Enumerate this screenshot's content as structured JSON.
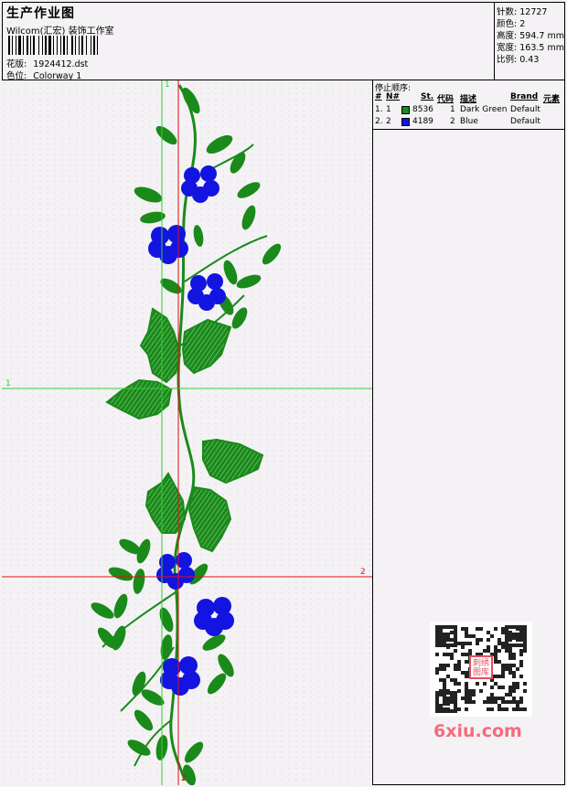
{
  "header": {
    "title": "生产作业图",
    "company": "Wilcom(汇宏) 装饰工作室",
    "file_label": "花版:",
    "file_value": "1924412.dst",
    "color_label": "色位:",
    "color_value": "Colorway 1"
  },
  "stats": [
    {
      "label": "针数:",
      "value": "12727"
    },
    {
      "label": "颜色:",
      "value": "2"
    },
    {
      "label": "高度:",
      "value": "594.7 mm"
    },
    {
      "label": "宽度:",
      "value": "163.5 mm"
    },
    {
      "label": "比例:",
      "value": "0.43"
    }
  ],
  "guides": {
    "v1": "1",
    "h1": "1",
    "h2": "2",
    "v2": "2"
  },
  "stop_sequence": {
    "caption": "停止顺序:",
    "columns": [
      "#",
      "N#",
      "St.",
      "代码",
      "描述",
      "Brand",
      "元素"
    ],
    "rows": [
      {
        "idx": "1.",
        "n": "1",
        "stitches": "8536",
        "code": "1",
        "desc": "Dark Green",
        "brand": "Default",
        "color": "#1a8a1a"
      },
      {
        "idx": "2.",
        "n": "2",
        "stitches": "4189",
        "code": "2",
        "desc": "Blue",
        "brand": "Default",
        "color": "#1414e0"
      }
    ]
  },
  "watermark": {
    "text": "6xiu.com",
    "seal": "刺绣图库"
  },
  "colors": {
    "leaf": "#1a8a1a",
    "flower": "#1414e0",
    "guide_green": "#33cc33",
    "guide_red": "#e01010"
  }
}
